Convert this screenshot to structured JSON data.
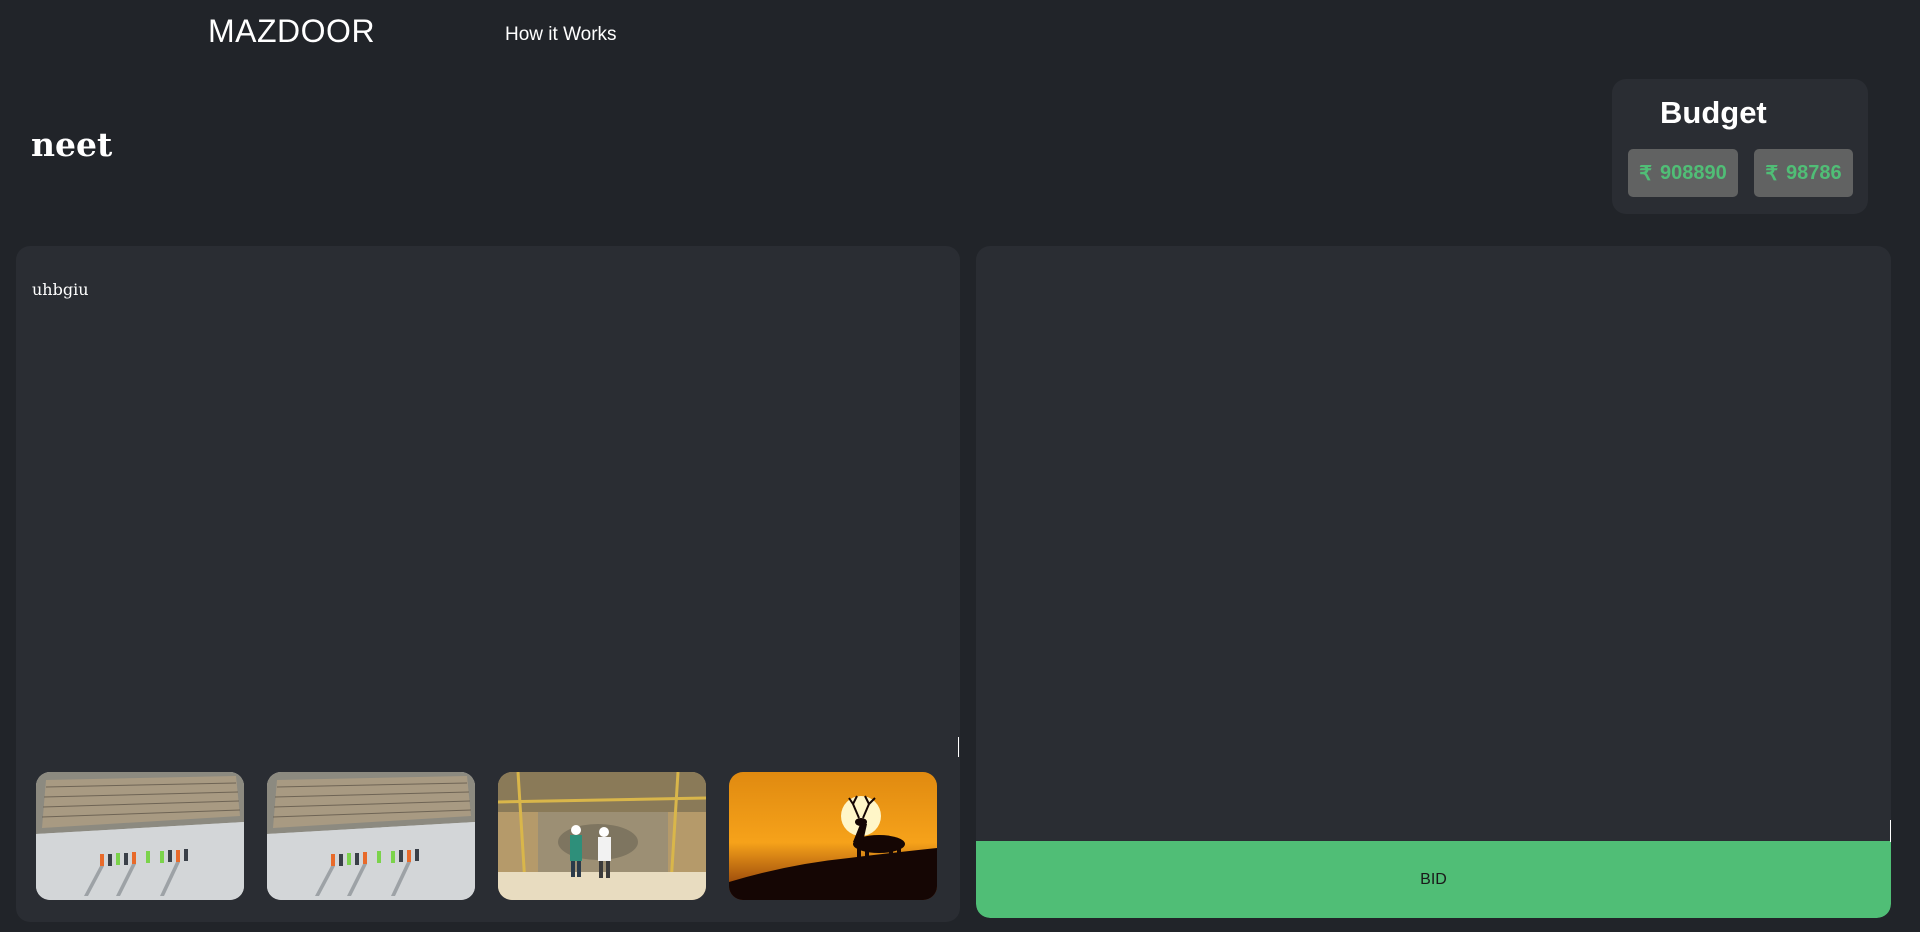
{
  "header": {
    "brand": "MAZDOOR",
    "nav_how_it_works": "How it Works"
  },
  "project": {
    "title": "neet",
    "description": "uhbgiu"
  },
  "budget": {
    "title": "Budget",
    "currency_symbol": "₹",
    "min": "908890",
    "max": "98786"
  },
  "images": [
    {
      "icon": "construction-site-workers-image"
    },
    {
      "icon": "construction-site-workers-image"
    },
    {
      "icon": "construction-engineers-image"
    },
    {
      "icon": "deer-sunset-image"
    }
  ],
  "bid": {
    "button_label": "BID"
  },
  "colors": {
    "background": "#212429",
    "panel": "#2a2d33",
    "accent_green": "#50be76",
    "pill_gray": "#616262"
  }
}
